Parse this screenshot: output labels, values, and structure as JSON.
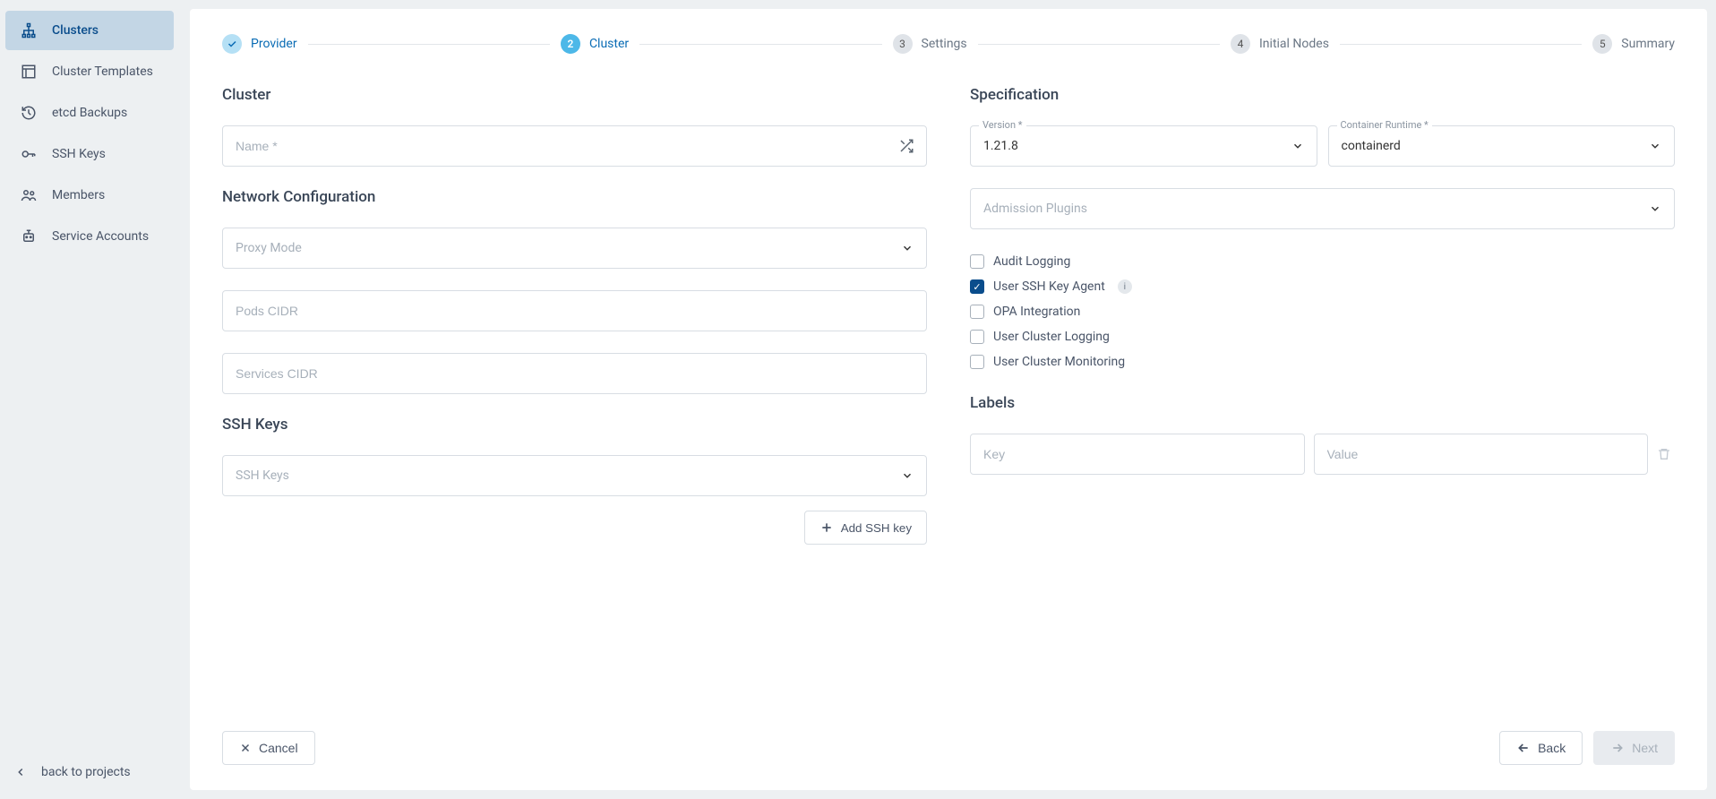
{
  "sidebar": {
    "items": [
      {
        "label": "Clusters",
        "icon": "cluster",
        "active": true
      },
      {
        "label": "Cluster Templates",
        "icon": "template",
        "active": false
      },
      {
        "label": "etcd Backups",
        "icon": "history",
        "active": false
      },
      {
        "label": "SSH Keys",
        "icon": "key",
        "active": false
      },
      {
        "label": "Members",
        "icon": "members",
        "active": false
      },
      {
        "label": "Service Accounts",
        "icon": "robot",
        "active": false
      }
    ],
    "back_label": "back to projects"
  },
  "stepper": {
    "steps": [
      {
        "num": "✓",
        "label": "Provider",
        "state": "done"
      },
      {
        "num": "2",
        "label": "Cluster",
        "state": "active"
      },
      {
        "num": "3",
        "label": "Settings",
        "state": "pending"
      },
      {
        "num": "4",
        "label": "Initial Nodes",
        "state": "pending"
      },
      {
        "num": "5",
        "label": "Summary",
        "state": "pending"
      }
    ]
  },
  "left": {
    "cluster_title": "Cluster",
    "name_placeholder": "Name *",
    "network_title": "Network Configuration",
    "proxy_placeholder": "Proxy Mode",
    "pods_placeholder": "Pods CIDR",
    "services_placeholder": "Services CIDR",
    "ssh_title": "SSH Keys",
    "ssh_select_placeholder": "SSH Keys",
    "add_ssh_label": "Add SSH key"
  },
  "right": {
    "spec_title": "Specification",
    "version_label": "Version *",
    "version_value": "1.21.8",
    "runtime_label": "Container Runtime *",
    "runtime_value": "containerd",
    "admission_placeholder": "Admission Plugins",
    "checkboxes": {
      "audit": {
        "label": "Audit Logging",
        "checked": false
      },
      "sshagent": {
        "label": "User SSH Key Agent",
        "checked": true,
        "info": true
      },
      "opa": {
        "label": "OPA Integration",
        "checked": false
      },
      "logging": {
        "label": "User Cluster Logging",
        "checked": false
      },
      "monitoring": {
        "label": "User Cluster Monitoring",
        "checked": false
      }
    },
    "labels_title": "Labels",
    "key_placeholder": "Key",
    "value_placeholder": "Value"
  },
  "footer": {
    "cancel": "Cancel",
    "back": "Back",
    "next": "Next"
  }
}
